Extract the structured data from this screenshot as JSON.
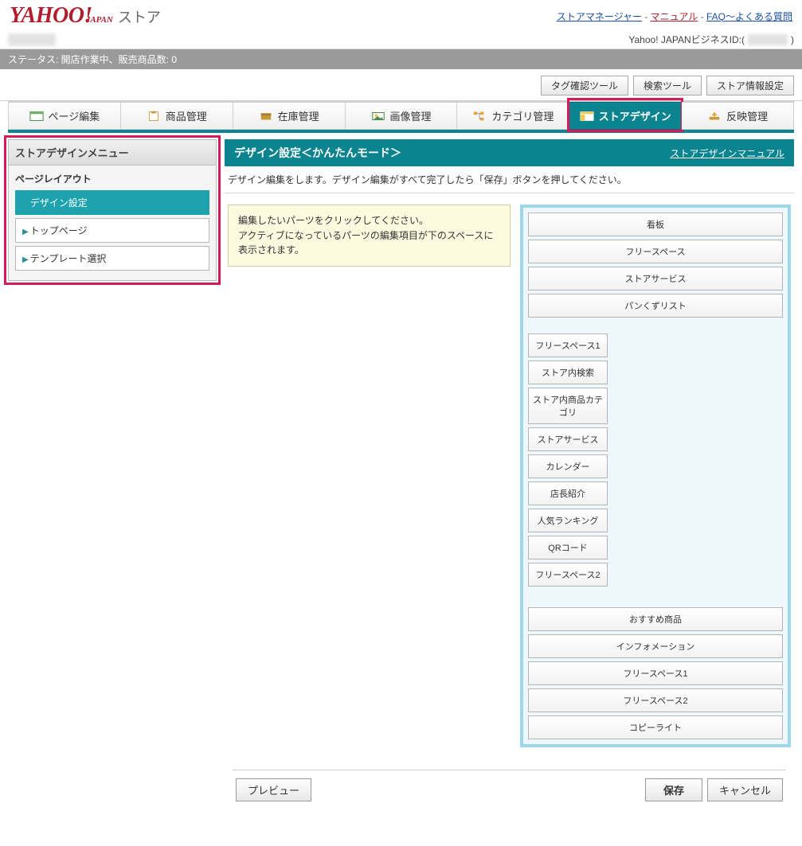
{
  "logo": {
    "brand": "YAHOO!",
    "sub": "JAPAN",
    "suffix": "ストア"
  },
  "top_links": {
    "store_manager": "ストアマネージャー",
    "manual": "マニュアル",
    "faq": "FAQ～よくある質問"
  },
  "account": {
    "label": "Yahoo! JAPANビジネスID:(",
    "tail": ")"
  },
  "status_bar": "ステータス: 開店作業中、販売商品数: 0",
  "tool_buttons": {
    "tag_check": "タグ確認ツール",
    "search": "検索ツール",
    "store_info": "ストア情報設定"
  },
  "nav": [
    {
      "key": "page-edit",
      "label": "ページ編集"
    },
    {
      "key": "product-mgmt",
      "label": "商品管理"
    },
    {
      "key": "stock-mgmt",
      "label": "在庫管理"
    },
    {
      "key": "image-mgmt",
      "label": "画像管理"
    },
    {
      "key": "category-mgmt",
      "label": "カテゴリ管理"
    },
    {
      "key": "store-design",
      "label": "ストアデザイン"
    },
    {
      "key": "publish-mgmt",
      "label": "反映管理"
    }
  ],
  "sidebar": {
    "header": "ストアデザインメニュー",
    "section_label": "ページレイアウト",
    "items": [
      {
        "label": "デザイン設定",
        "active": true
      },
      {
        "label": "トップページ"
      },
      {
        "label": "テンプレート選択"
      }
    ]
  },
  "main": {
    "title": "デザイン設定＜かんたんモード＞",
    "manual_link": "ストアデザインマニュアル",
    "description": "デザイン編集をします。デザイン編集がすべて完了したら「保存」ボタンを押してください。",
    "hint_l1": "編集したいパーツをクリックしてください。",
    "hint_l2": "アクティブになっているパーツの編集項目が下のスペースに表示されます。"
  },
  "layout": {
    "top": [
      "看板",
      "フリースペース",
      "ストアサービス",
      "パンくずリスト"
    ],
    "mid": [
      "フリースペース1",
      "ストア内検索",
      "ストア内商品カテゴリ",
      "ストアサービス",
      "カレンダー",
      "店長紹介",
      "人気ランキング",
      "QRコード",
      "フリースペース2"
    ],
    "bottom": [
      "おすすめ商品",
      "インフォメーション",
      "フリースペース1",
      "フリースペース2",
      "コピーライト"
    ]
  },
  "footer": {
    "preview": "プレビュー",
    "save": "保存",
    "cancel": "キャンセル"
  }
}
